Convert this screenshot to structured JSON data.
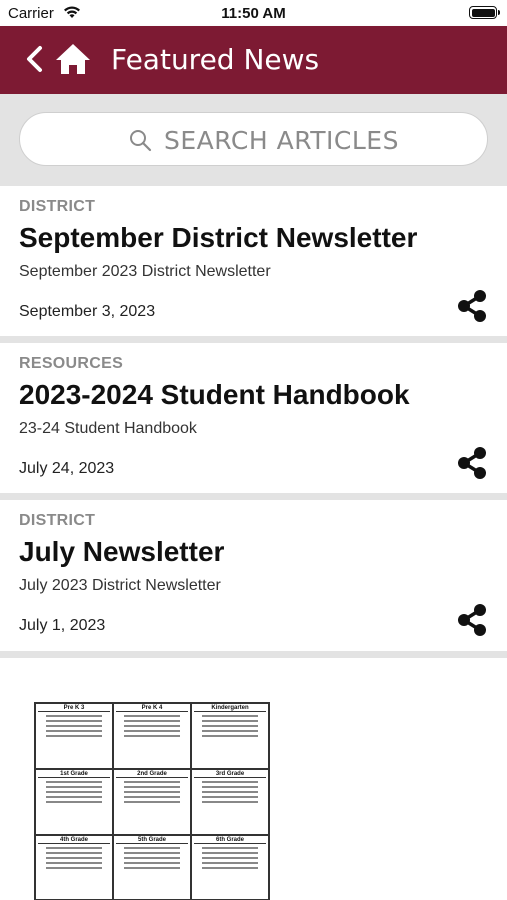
{
  "status_bar": {
    "carrier": "Carrier",
    "time": "11:50 AM"
  },
  "nav": {
    "title": "Featured News",
    "back_icon": "chevron-left-icon",
    "home_icon": "home-icon"
  },
  "search": {
    "placeholder": "SEARCH ARTICLES"
  },
  "articles": [
    {
      "category": "DISTRICT",
      "title": "September District Newsletter",
      "subtitle": "September 2023 District Newsletter",
      "date": "September 3, 2023"
    },
    {
      "category": "RESOURCES",
      "title": "2023-2024 Student Handbook",
      "subtitle": "23-24 Student Handbook",
      "date": "July 24, 2023"
    },
    {
      "category": "DISTRICT",
      "title": "July Newsletter",
      "subtitle": "July 2023 District Newsletter",
      "date": "July 1, 2023"
    }
  ],
  "thumbnail": {
    "grades": [
      "Pre K 3",
      "Pre K 4",
      "Kindergarten",
      "1st Grade",
      "2nd Grade",
      "3rd Grade",
      "4th Grade",
      "5th Grade",
      "6th Grade"
    ]
  },
  "colors": {
    "brand": "#7d1a33",
    "divider": "#e3e3e3"
  }
}
